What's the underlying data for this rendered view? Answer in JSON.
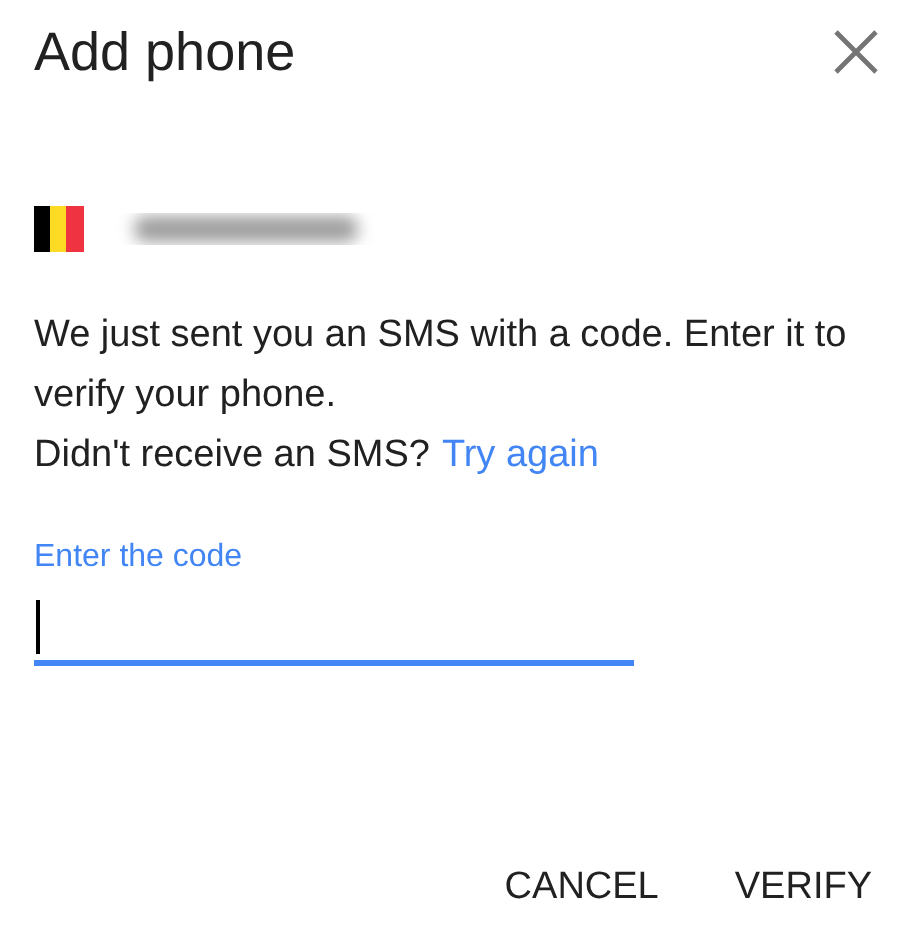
{
  "dialog": {
    "title": "Add phone"
  },
  "message": "We just sent you an SMS with a code. Enter it to verify your phone.",
  "resend": {
    "text": "Didn't receive an SMS?",
    "link": "Try again"
  },
  "code_field": {
    "label": "Enter the code",
    "focused": true
  },
  "buttons": [
    "CANCEL",
    "VERIFY"
  ]
}
